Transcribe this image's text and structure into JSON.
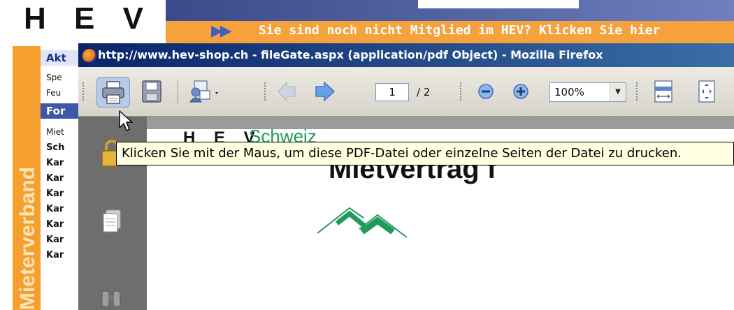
{
  "site": {
    "logo": "H E V",
    "member_banner": "Sie sind noch nicht Mitglied im HEV? Klicken Sie hier",
    "side_title": "Mieterverband",
    "nav": [
      {
        "label": "Akt",
        "style": "hdr"
      },
      {
        "label": "Spe",
        "style": "normal"
      },
      {
        "label": "Feu",
        "style": "normal"
      },
      {
        "label": "For",
        "style": "hdr"
      },
      {
        "label": "Miet",
        "style": "normal"
      },
      {
        "label": "Sch",
        "style": "bold"
      },
      {
        "label": "Kar",
        "style": "bold"
      },
      {
        "label": "Kar",
        "style": "bold"
      },
      {
        "label": "Kar",
        "style": "bold"
      },
      {
        "label": "Kar",
        "style": "bold"
      },
      {
        "label": "Kar",
        "style": "bold"
      },
      {
        "label": "Kar",
        "style": "bold"
      },
      {
        "label": "Kar",
        "style": "bold"
      }
    ]
  },
  "window": {
    "title": "http://www.hev-shop.ch - fileGate.aspx (application/pdf Object) - Mozilla Firefox",
    "browser_icon": "firefox-icon"
  },
  "pdf_toolbar": {
    "current_page": "1",
    "page_total": "/ 2",
    "zoom": "100%",
    "buttons": [
      "print-icon",
      "save-icon",
      "email-icon",
      "previous-page-icon",
      "next-page-icon",
      "zoom-out-icon",
      "zoom-in-icon",
      "fit-width-icon",
      "fit-page-icon"
    ]
  },
  "pdf_sidebar": {
    "icons": [
      "lock-icon",
      "pages-icon",
      "binoculars-icon"
    ]
  },
  "document": {
    "logo_name": "H E V",
    "logo_region": "Schweiz",
    "title": "Mietvertrag f"
  },
  "tooltip": {
    "text": "Klicken Sie mit der Maus, um diese PDF-Datei oder einzelne Seiten der Datei zu drucken."
  },
  "colors": {
    "banner_orange": "#f6a23c",
    "nav_blue": "#3f57a8",
    "hev_green": "#1f9a5a",
    "titlebar_blue": "#0a246a"
  }
}
